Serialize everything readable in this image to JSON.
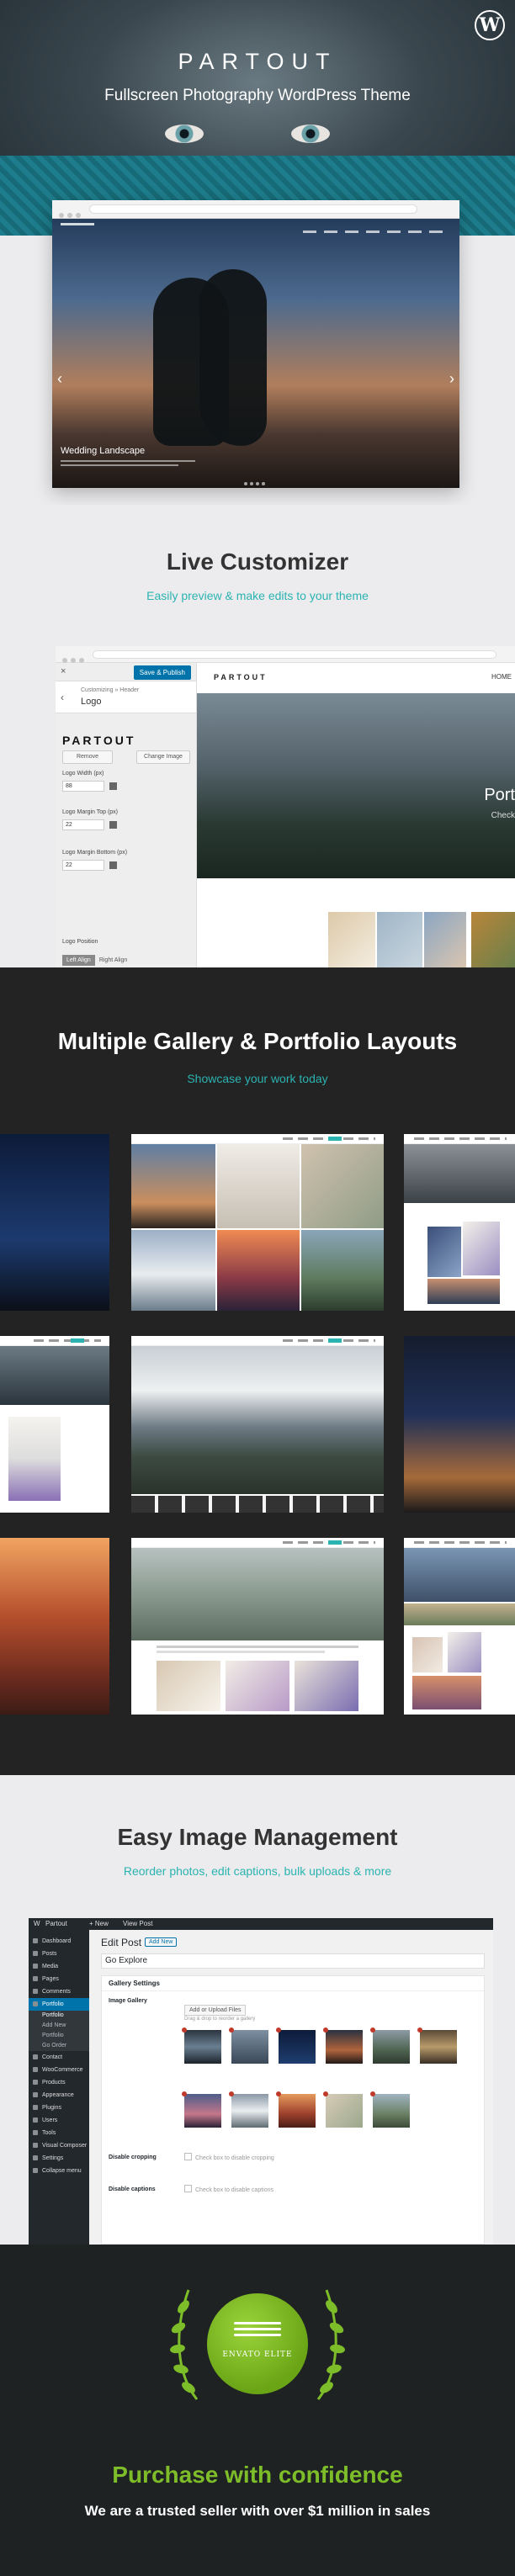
{
  "hero": {
    "title": "PARTOUT",
    "subtitle": "Fullscreen Photography WordPress Theme",
    "wp_icon": "wordpress-icon",
    "demo_caption": "Wedding Landscape",
    "prev_icon": "chevron-left-icon",
    "next_icon": "chevron-right-icon"
  },
  "customizer": {
    "title": "Live Customizer",
    "subtitle": "Easily preview & make edits to your theme",
    "panel": {
      "close": "×",
      "save_button": "Save & Publish",
      "crumb": "Customizing » Header",
      "heading": "Logo",
      "logo_text": "PARTOUT",
      "remove_button": "Remove",
      "change_button": "Change Image",
      "logo_width_label": "Logo Width (px)",
      "logo_width_value": "88",
      "margin_top_label": "Logo Margin Top (px)",
      "margin_top_value": "22",
      "margin_bottom_label": "Logo Margin Bottom (px)",
      "margin_bottom_value": "22",
      "position_label": "Logo Position",
      "align_left": "Left Align",
      "align_right": "Right Align"
    },
    "preview": {
      "logo": "PARTOUT",
      "nav_home": "HOME",
      "hero_title": "Port",
      "hero_sub": "Check"
    }
  },
  "gallery": {
    "title": "Multiple Gallery & Portfolio Layouts",
    "subtitle": "Showcase your work today"
  },
  "image_management": {
    "title": "Easy Image Management",
    "subtitle": "Reorder photos, edit captions, bulk uploads & more",
    "admin": {
      "bar": [
        "Partout",
        "+ New",
        "View Post"
      ],
      "menu": [
        "Dashboard",
        "Posts",
        "Media",
        "Pages",
        "Comments",
        "Portfolio"
      ],
      "submenu": [
        "Portfolio",
        "Add New",
        "Portfolio Categories",
        "Go Order"
      ],
      "menu_after": [
        "Contact",
        "WooCommerce",
        "Products",
        "Appearance",
        "Plugins",
        "Users",
        "Tools",
        "Visual Composer",
        "Settings",
        "Collapse menu"
      ],
      "page_title": "Edit Post",
      "add_new": "Add New",
      "post_title": "Go Explore",
      "box_title": "Gallery Settings",
      "image_gallery_label": "Image Gallery",
      "upload_button": "Add or Upload Files",
      "upload_hint": "Drag & drop to reorder a gallery",
      "disable_cropping_label": "Disable cropping",
      "disable_cropping_check": "Check box to disable cropping",
      "disable_captions_label": "Disable captions",
      "disable_captions_check": "Check box to disable captions"
    }
  },
  "elite": {
    "badge": "ENVATO ELITE",
    "title": "Purchase with confidence",
    "subtitle": "We are a trusted seller with over $1 million in sales"
  },
  "colors": {
    "accent": "#2bb3b1",
    "elite_green": "#7ebd2a",
    "wp_blue": "#0073aa",
    "admin_dark": "#23282d"
  }
}
